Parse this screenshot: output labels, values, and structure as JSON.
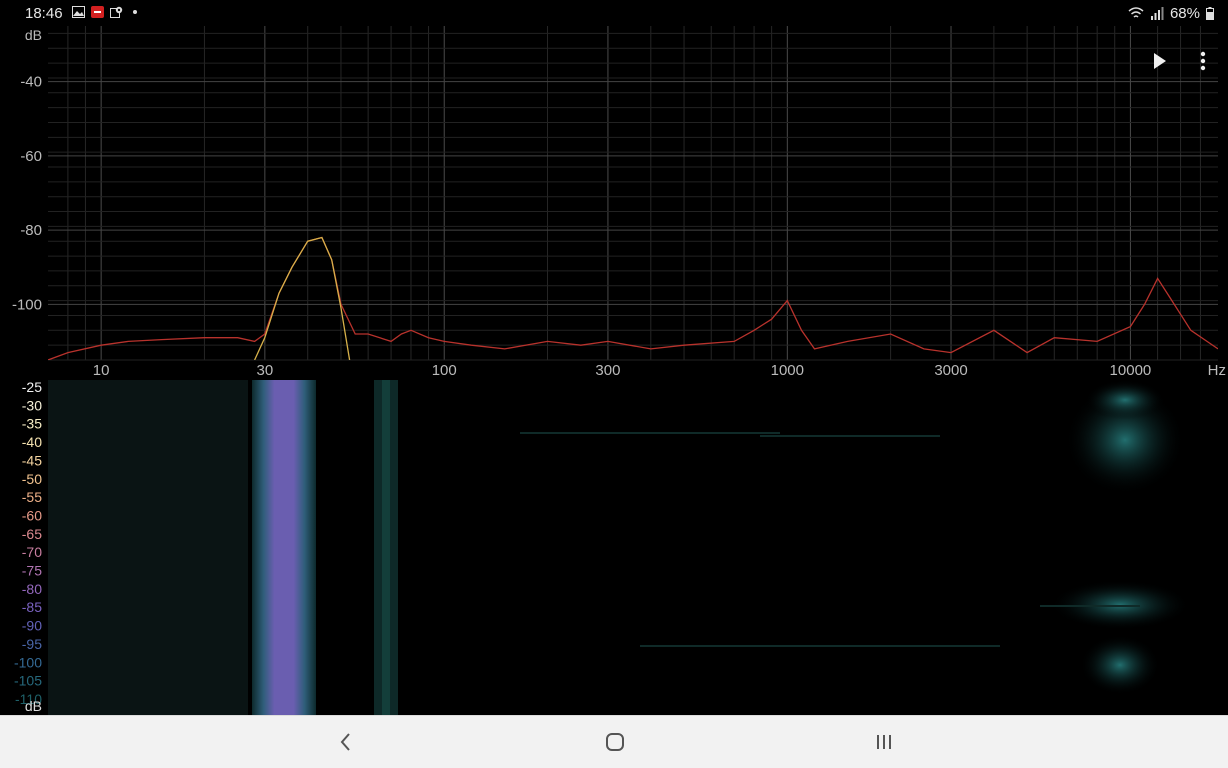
{
  "status": {
    "time": "18:46",
    "battery": "68%",
    "icons": [
      "gallery-icon",
      "app-notification-icon",
      "location-icon",
      "dot-icon",
      "wifi-icon",
      "signal-icon",
      "battery-icon"
    ]
  },
  "toolbar": {
    "play_icon": "play-icon",
    "menu_icon": "more-vert-icon"
  },
  "spectrum": {
    "y_unit": "dB",
    "y_ticks": [
      "-40",
      "-60",
      "-80",
      "-100"
    ],
    "x_unit": "Hz",
    "x_ticks": [
      "10",
      "30",
      "100",
      "300",
      "1000",
      "3000",
      "10000"
    ]
  },
  "spectrogram": {
    "scale_unit": "dB",
    "scale_labels": [
      "-25",
      "-30",
      "-35",
      "-40",
      "-45",
      "-50",
      "-55",
      "-60",
      "-65",
      "-70",
      "-75",
      "-80",
      "-85",
      "-90",
      "-95",
      "-100",
      "-105",
      "-110"
    ]
  },
  "chart_data": {
    "type": "line",
    "xlabel": "Hz",
    "ylabel": "dB",
    "x_scale": "log",
    "xlim": [
      7,
      18000
    ],
    "ylim": [
      -115,
      -25
    ],
    "grid": true,
    "series": [
      {
        "color": "#b8322c",
        "x": [
          7,
          8,
          10,
          12,
          15,
          20,
          25,
          28,
          30,
          33,
          36,
          40,
          44,
          47,
          50,
          55,
          60,
          70,
          75,
          80,
          90,
          100,
          120,
          150,
          200,
          250,
          300,
          400,
          500,
          700,
          800,
          900,
          1000,
          1100,
          1200,
          1500,
          2000,
          2500,
          3000,
          4000,
          5000,
          6000,
          8000,
          10000,
          11000,
          12000,
          13000,
          15000,
          18000
        ],
        "y": [
          -115,
          -113,
          -111,
          -110,
          -109.5,
          -109,
          -109,
          -110,
          -108,
          -97,
          -90,
          -83,
          -82,
          -88,
          -100,
          -108,
          -108,
          -110,
          -108,
          -107,
          -109,
          -110,
          -111,
          -112,
          -110,
          -111,
          -110,
          -112,
          -111,
          -110,
          -107,
          -104,
          -99,
          -107,
          -112,
          -110,
          -108,
          -112,
          -113,
          -107,
          -113,
          -109,
          -110,
          -106,
          -100,
          -93,
          -98,
          -107,
          -112
        ]
      },
      {
        "color": "#d7b14a",
        "x": [
          28,
          30,
          33,
          36,
          40,
          44,
          47,
          50,
          53
        ],
        "y": [
          -115,
          -109,
          -97,
          -90,
          -83,
          -82,
          -88,
          -101,
          -115
        ]
      }
    ]
  },
  "colors": {
    "grid": "#3a3a3a",
    "spectrum_red": "#b8322c",
    "spectrum_yellow": "#d7b14a",
    "spectrogram_band": "#6d5fb0",
    "spectrogram_teal": "#1a6a63",
    "navbar_bg": "#f2f2f2"
  },
  "navbar": {
    "back_icon": "back-chevron-icon",
    "home_icon": "home-icon",
    "recents_icon": "recents-icon"
  }
}
